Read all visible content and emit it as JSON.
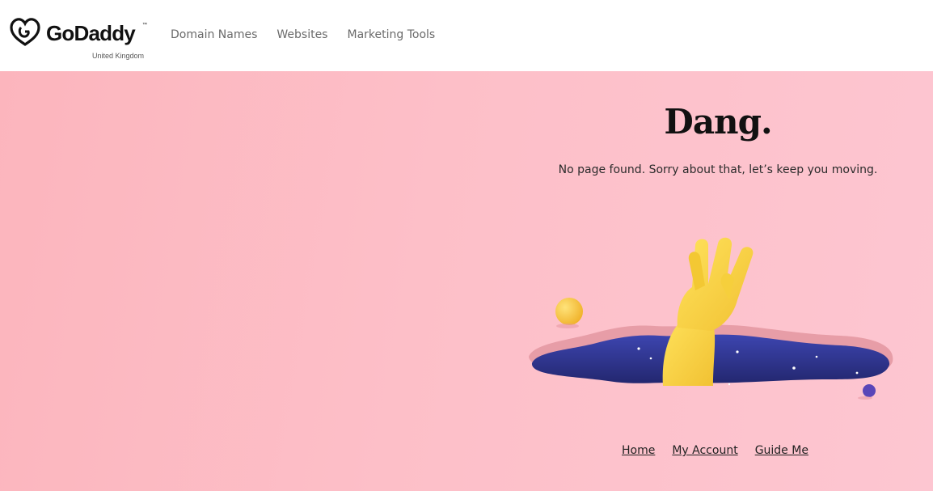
{
  "header": {
    "brand": "GoDaddy",
    "region": "United Kingdom",
    "nav": [
      "Domain Names",
      "Websites",
      "Marketing Tools"
    ]
  },
  "hero": {
    "title": "Dang.",
    "subtitle": "No page found. Sorry about that, let’s keep you moving.",
    "illustration": "hand-waving-from-hole-illustration"
  },
  "links": [
    "Home",
    "My Account",
    "Guide Me"
  ],
  "colors": {
    "background_pink": "#fdbfc8",
    "hole_navy": "#2d3192",
    "hand_yellow": "#f7d23c"
  }
}
